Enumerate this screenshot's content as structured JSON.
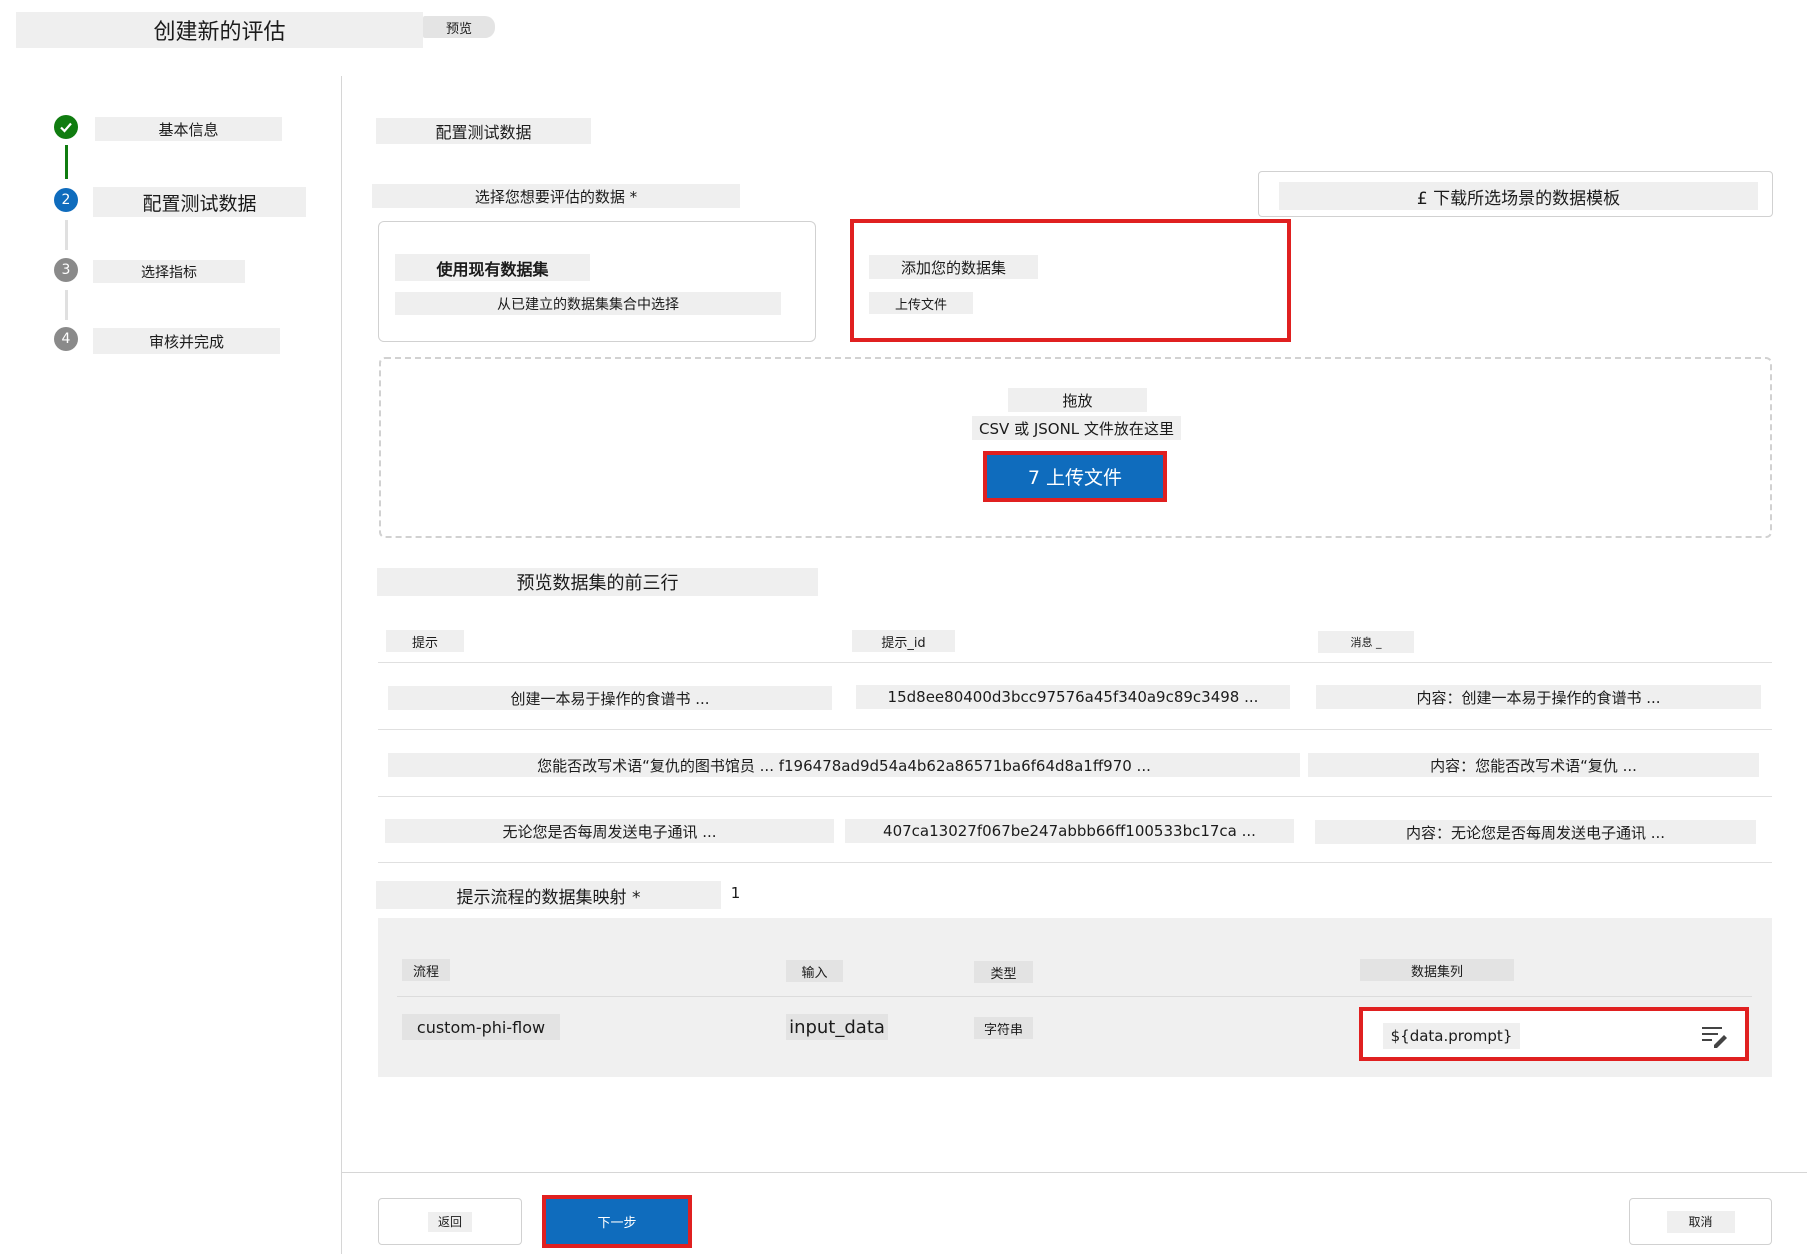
{
  "header": {
    "title": "创建新的评估",
    "badge": "预览"
  },
  "steps": [
    {
      "num": "✓",
      "label": "基本信息",
      "state": "done"
    },
    {
      "num": "2",
      "label": "配置测试数据",
      "state": "current"
    },
    {
      "num": "3",
      "label": "选择指标",
      "state": "pending"
    },
    {
      "num": "4",
      "label": "审核并完成",
      "state": "pending"
    }
  ],
  "main": {
    "section_title": "配置测试数据",
    "select_label": "选择您想要评估的数据 *",
    "download_button": "£ 下载所选场景的数据模板",
    "option_existing": {
      "title": "使用现有数据集",
      "subtitle": "从已建立的数据集集合中选择"
    },
    "option_add": {
      "title": "添加您的数据集",
      "subtitle": "上传文件"
    },
    "dropzone": {
      "line1": "拖放",
      "line2": "CSV 或 JSONL 文件放在这里",
      "button": "7 上传文件"
    },
    "preview_title": "预览数据集的前三行",
    "preview_table": {
      "headers": [
        "提示",
        "提示_id",
        "消息 _"
      ],
      "rows": [
        [
          "创建一本易于操作的食谱书 ...",
          "15d8ee80400d3bcc97576a45f340a9c89c3498 ...",
          "内容：创建一本易于操作的食谱书 ..."
        ],
        [
          "您能否改写术语“复仇的图书馆员 ... f196478ad9d54a4b62a86571ba6f64d8a1ff970 ...",
          "",
          "内容：您能否改写术语“复仇 ..."
        ],
        [
          "无论您是否每周发送电子通讯 ...",
          "407ca13027f067be247abbb66ff100533bc17ca ...",
          "内容：无论您是否每周发送电子通讯 ..."
        ]
      ]
    },
    "mapping": {
      "title": "提示流程的数据集映射 *",
      "count": "1",
      "headers": [
        "流程",
        "输入",
        "类型",
        "数据集列"
      ],
      "row": {
        "flow": "custom-phi-flow",
        "input": "input_data",
        "type": "字符串",
        "column": "${data.prompt}"
      }
    }
  },
  "footer": {
    "back": "返回",
    "next": "下一步",
    "cancel": "取消"
  },
  "colors": {
    "accent": "#0f6cbd",
    "success": "#107c10",
    "highlight": "#e02020"
  }
}
